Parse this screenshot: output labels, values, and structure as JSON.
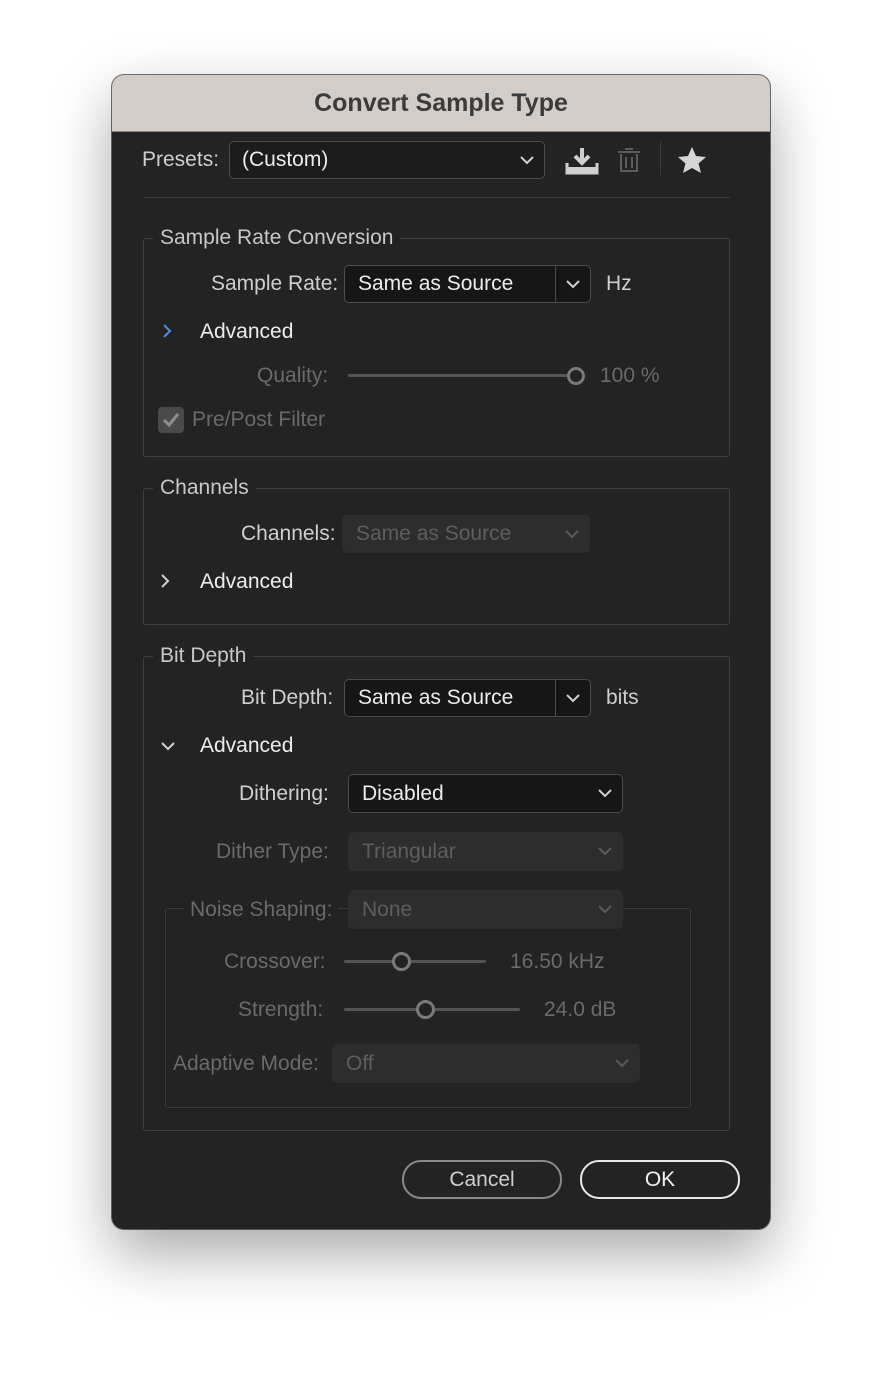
{
  "window": {
    "title": "Convert Sample Type"
  },
  "presets": {
    "label": "Presets:",
    "value": "(Custom)"
  },
  "icons": [
    "download-icon",
    "trash-icon",
    "star-icon",
    "chevron-down-icon",
    "chevron-right-icon"
  ],
  "colors": {
    "accent": "#4a8fe0",
    "window_bg": "#232323",
    "titlebar_bg": "#d2cdc9"
  },
  "sample_rate_conversion": {
    "legend": "Sample Rate Conversion",
    "sample_rate_label": "Sample Rate:",
    "sample_rate_value": "Same as Source",
    "unit": "Hz",
    "advanced_label": "Advanced",
    "advanced_expanded": false,
    "quality_label": "Quality:",
    "quality_value": 100,
    "quality_text": "100 %",
    "filter_label": "Pre/Post Filter",
    "filter_checked": true
  },
  "channels": {
    "legend": "Channels",
    "channels_label": "Channels:",
    "channels_value": "Same as Source",
    "advanced_label": "Advanced",
    "advanced_expanded": false
  },
  "bit_depth": {
    "legend": "Bit Depth",
    "bit_depth_label": "Bit Depth:",
    "bit_depth_value": "Same as Source",
    "unit": "bits",
    "advanced_label": "Advanced",
    "advanced_expanded": true,
    "dithering_label": "Dithering:",
    "dithering_value": "Disabled",
    "dither_type_label": "Dither Type:",
    "dither_type_value": "Triangular",
    "noise_shaping_label": "Noise Shaping:",
    "noise_shaping_value": "None",
    "crossover_label": "Crossover:",
    "crossover_text": "16.50 kHz",
    "crossover_fraction": 0.4,
    "strength_label": "Strength:",
    "strength_text": "24.0 dB",
    "strength_fraction": 0.46,
    "adaptive_label": "Adaptive Mode:",
    "adaptive_value": "Off"
  },
  "buttons": {
    "cancel": "Cancel",
    "ok": "OK"
  }
}
